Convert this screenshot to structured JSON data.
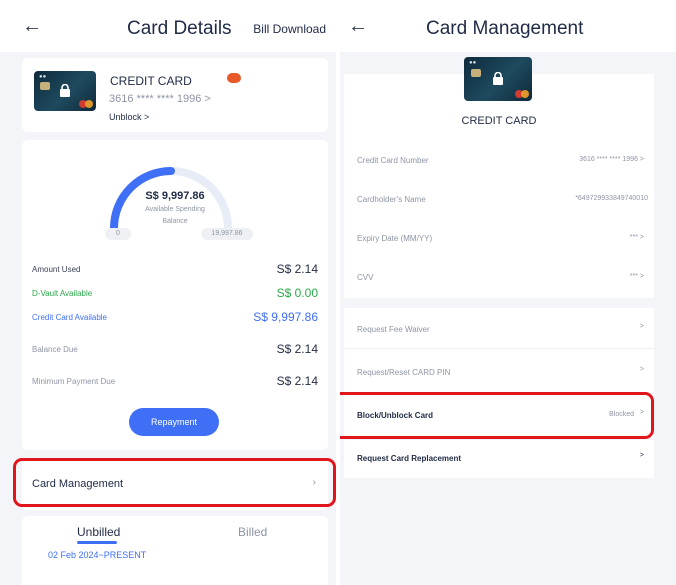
{
  "left": {
    "header": {
      "back_icon": "back-arrow-icon",
      "title": "Card Details",
      "link": "Bill Download"
    },
    "card": {
      "name": "CREDIT CARD",
      "number": "3616 **** **** 1996 >",
      "unblock": "Unblock >"
    },
    "gauge": {
      "amount": "S$ 9,997.86",
      "caption_line1": "Available Spending",
      "caption_line2": "Balance",
      "min": "0",
      "max": "19,997.86",
      "fraction": 0.5
    },
    "rows": [
      {
        "label": "Amount Used",
        "value": "S$ 2.14",
        "label_color": "#3b4254",
        "value_color": "#1f2a44"
      },
      {
        "label": "D-Vault Available",
        "value": "S$ 0.00",
        "label_color": "#2aa84a",
        "value_color": "#2aa84a"
      },
      {
        "label": "Credit Card Available",
        "value": "S$ 9,997.86",
        "label_color": "#3f6ff5",
        "value_color": "#3f6ff5"
      },
      {
        "label": "Balance Due",
        "value": "S$ 2.14",
        "label_color": "#8e95a6",
        "value_color": "#1f2a44"
      },
      {
        "label": "Minimum Payment Due",
        "value": "S$ 2.14",
        "label_color": "#8e95a6",
        "value_color": "#1f2a44"
      }
    ],
    "repayment": "Repayment",
    "card_management": "Card Management",
    "tabs": [
      {
        "label": "Unbilled"
      },
      {
        "label": "Billed"
      }
    ],
    "period": "02 Feb 2024~PRESENT"
  },
  "right": {
    "header": {
      "back_icon": "back-arrow-icon",
      "title": "Card Management"
    },
    "card_title": "CREDIT CARD",
    "info": [
      {
        "label": "Credit Card Number",
        "value": "3616 **** **** 1996 >"
      },
      {
        "label": "Cardholder's Name",
        "value": "*649729933849740010"
      },
      {
        "label": "Expiry Date (MM/YY)",
        "value": "*** >"
      },
      {
        "label": "CVV",
        "value": "*** >"
      }
    ],
    "actions": [
      {
        "label": "Request Fee Waiver",
        "value": "",
        "chevron": ">"
      },
      {
        "label": "Request/Reset CARD PIN",
        "value": "",
        "chevron": ">"
      },
      {
        "label": "Block/Unblock Card",
        "value": "Blocked",
        "chevron": ">"
      },
      {
        "label": "Request Card Replacement",
        "value": "",
        "chevron": ">"
      }
    ]
  },
  "colors": {
    "accent": "#3f6ff5",
    "highlight": "#e0161c",
    "success": "#2aa84a"
  }
}
